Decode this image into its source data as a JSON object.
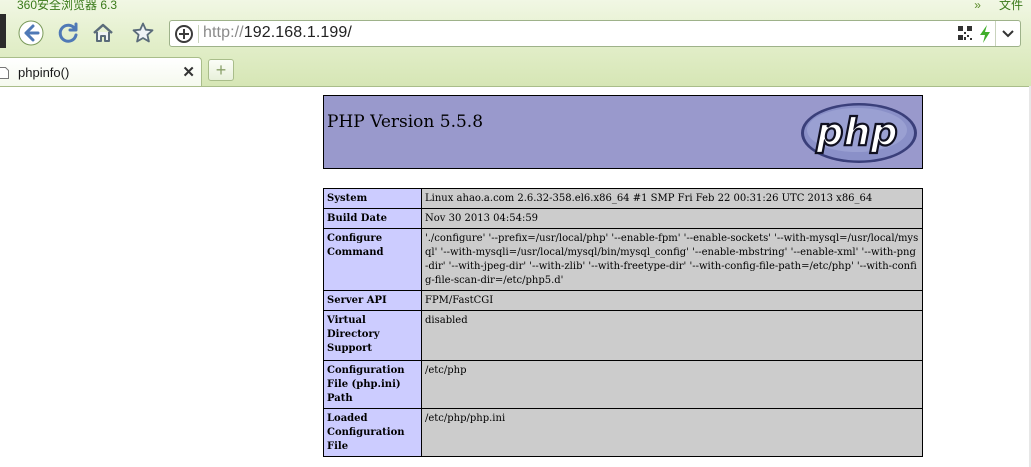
{
  "browser": {
    "title": "360安全浏览器 6.3",
    "menu_label": "文件",
    "address": {
      "protocol": "http://",
      "host_path": "192.168.1.199/"
    },
    "tabs": [
      {
        "label": "phpinfo()"
      }
    ],
    "icons": [
      "back-icon",
      "refresh-icon",
      "home-icon",
      "favorite-star-icon",
      "security-shield-icon",
      "qr-code-icon",
      "bolt-icon",
      "dropdown-icon",
      "close-icon",
      "new-tab-icon"
    ]
  },
  "page": {
    "heading": "PHP Version 5.5.8",
    "logo_text": "php",
    "colors": {
      "header_bg": "#9999cc",
      "label_bg": "#ccccff",
      "value_bg": "#cccccc"
    },
    "rows": [
      {
        "label": "System",
        "value": "Linux ahao.a.com 2.6.32-358.el6.x86_64 #1 SMP Fri Feb 22 00:31:26 UTC 2013 x86_64"
      },
      {
        "label": "Build Date",
        "value": "Nov 30 2013 04:54:59"
      },
      {
        "label": "Configure Command",
        "value": "'./configure' '--prefix=/usr/local/php' '--enable-fpm' '--enable-sockets' '--with-mysql=/usr/local/mysql' '--with-mysqli=/usr/local/mysql/bin/mysql_config' '--enable-mbstring' '--enable-xml' '--with-png-dir' '--with-jpeg-dir' '--with-zlib' '--with-freetype-dir' '--with-config-file-path=/etc/php' '--with-config-file-scan-dir=/etc/php5.d'"
      },
      {
        "label": "Server API",
        "value": "FPM/FastCGI"
      },
      {
        "label": "Virtual Directory Support",
        "value": "disabled"
      },
      {
        "label": "Configuration File (php.ini) Path",
        "value": "/etc/php"
      },
      {
        "label": "Loaded Configuration File",
        "value": "/etc/php/php.ini"
      }
    ]
  }
}
